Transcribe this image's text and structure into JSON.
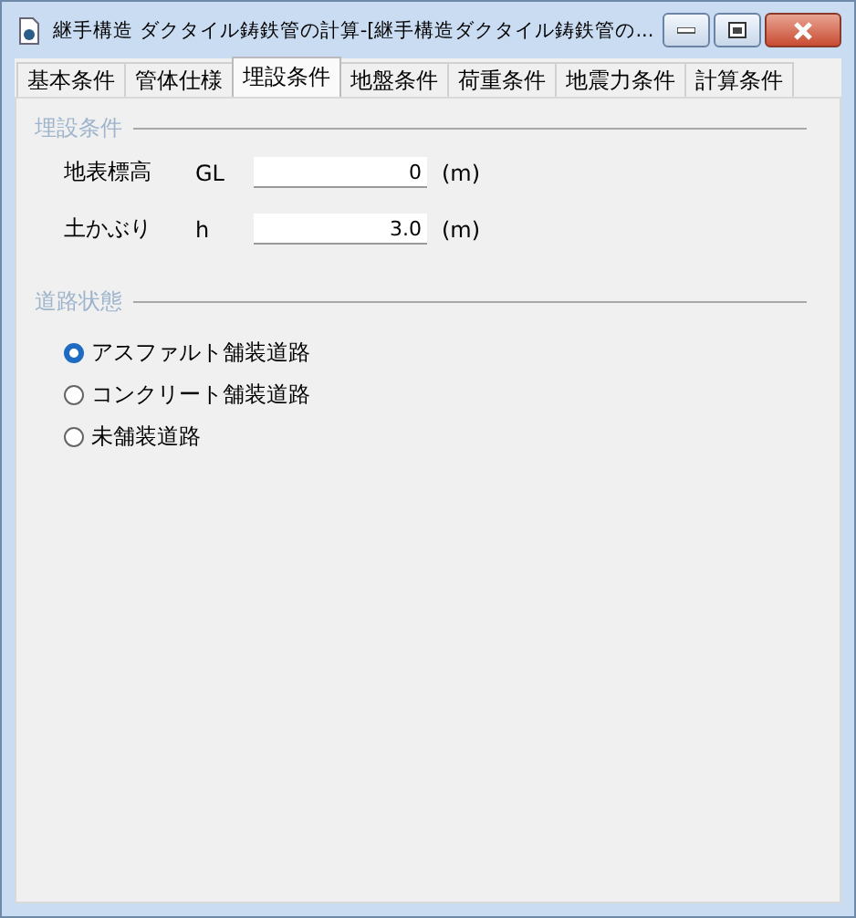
{
  "window": {
    "title": "継手構造 ダクタイル鋳鉄管の計算-[継手構造ダクタイル鋳鉄管の..."
  },
  "tabs": [
    {
      "label": "基本条件",
      "selected": false
    },
    {
      "label": "管体仕様",
      "selected": false
    },
    {
      "label": "埋設条件",
      "selected": true
    },
    {
      "label": "地盤条件",
      "selected": false
    },
    {
      "label": "荷重条件",
      "selected": false
    },
    {
      "label": "地震力条件",
      "selected": false
    },
    {
      "label": "計算条件",
      "selected": false
    }
  ],
  "burial": {
    "heading": "埋設条件",
    "fields": [
      {
        "label": "地表標高",
        "symbol": "GL",
        "value": "0",
        "unit": "(m)"
      },
      {
        "label": "土かぶり",
        "symbol": "h",
        "value": "3.0",
        "unit": "(m)"
      }
    ]
  },
  "road": {
    "heading": "道路状態",
    "options": [
      {
        "label": "アスファルト舗装道路",
        "selected": true
      },
      {
        "label": "コンクリート舗装道路",
        "selected": false
      },
      {
        "label": "未舗装道路",
        "selected": false
      }
    ]
  }
}
